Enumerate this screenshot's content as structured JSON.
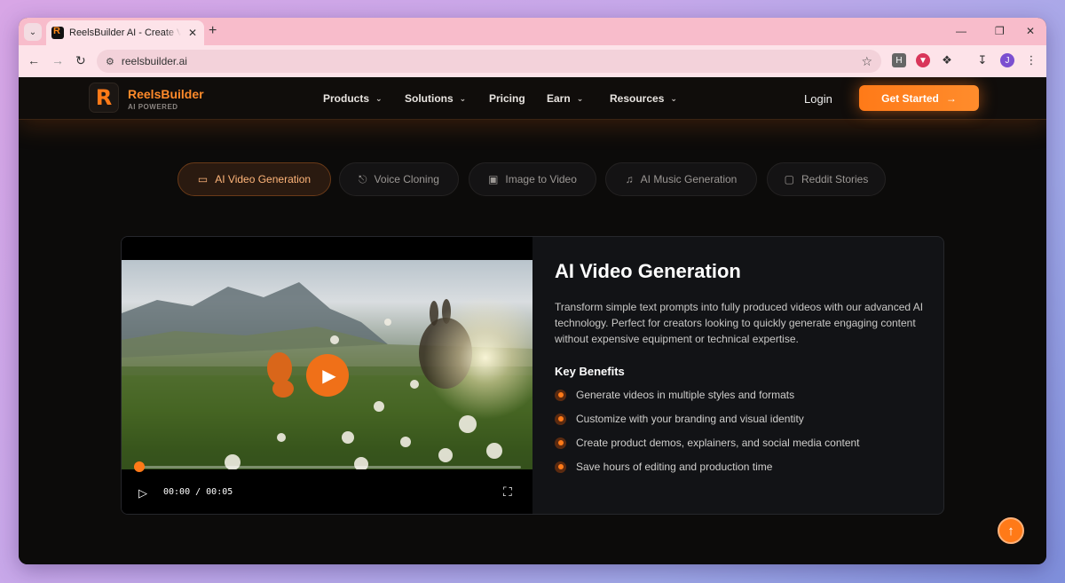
{
  "browser": {
    "tab_title": "ReelsBuilder AI - Create Viral Content",
    "tab_close": "✕",
    "new_tab": "+",
    "url": "reelsbuilder.ai",
    "profile_initial": "J",
    "ext_h": "H"
  },
  "site": {
    "brand": "ReelsBuilder",
    "brand_sub": "AI POWERED",
    "nav": [
      {
        "label": "Products"
      },
      {
        "label": "Solutions"
      },
      {
        "label": "Pricing"
      },
      {
        "label": "Earn"
      },
      {
        "label": "Resources"
      }
    ],
    "login": "Login",
    "cta": "Get Started",
    "cta_arrow": "→",
    "accent": "#ff7a18"
  },
  "feature_tabs": [
    {
      "label": "AI Video Generation",
      "icon": "video-camera-icon"
    },
    {
      "label": "Voice Cloning",
      "icon": "microphone-icon"
    },
    {
      "label": "Image to Video",
      "icon": "image-icon"
    },
    {
      "label": "AI Music Generation",
      "icon": "music-note-icon"
    },
    {
      "label": "Reddit Stories",
      "icon": "chat-bubble-icon"
    }
  ],
  "feature": {
    "title": "AI Video Generation",
    "description": "Transform simple text prompts into fully produced videos with our advanced AI technology. Perfect for creators looking to quickly generate engaging content without expensive equipment or technical expertise.",
    "benefits_heading": "Key Benefits",
    "benefits": [
      "Generate videos in multiple styles and formats",
      "Customize with your branding and visual identity",
      "Create product demos, explainers, and social media content",
      "Save hours of editing and production time"
    ]
  },
  "video": {
    "time": "00:00 / 00:05",
    "progress": 0
  }
}
